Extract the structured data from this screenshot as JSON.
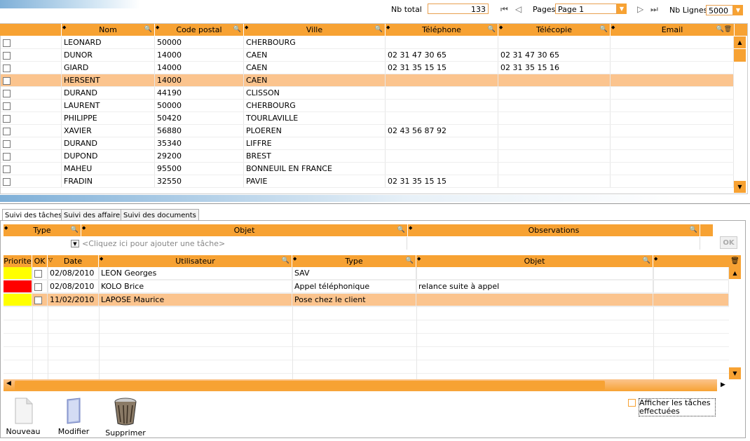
{
  "header": {
    "nb_total_label": "Nb total",
    "nb_total_value": "133",
    "pages_label": "Pages",
    "page_value": "Page 1",
    "nb_lignes_label": "Nb Lignes",
    "nb_lignes_value": "5000"
  },
  "contacts": {
    "columns": [
      "Nom",
      "Code postal",
      "Ville",
      "Téléphone",
      "Télécopie",
      "Email"
    ],
    "rows": [
      [
        "LEONARD",
        "50000",
        "CHERBOURG",
        "",
        "",
        ""
      ],
      [
        "DUNOR",
        "14000",
        "CAEN",
        "02 31 47 30 65",
        "02 31 47 30 65",
        ""
      ],
      [
        "GIARD",
        "14000",
        "CAEN",
        "02 31 35 15 15",
        "02 31 35 15 16",
        ""
      ],
      [
        "HERSENT",
        "14000",
        "CAEN",
        "",
        "",
        ""
      ],
      [
        "DURAND",
        "44190",
        "CLISSON",
        "",
        "",
        ""
      ],
      [
        "LAURENT",
        "50000",
        "CHERBOURG",
        "",
        "",
        ""
      ],
      [
        "PHILIPPE",
        "50420",
        "TOURLAVILLE",
        "",
        "",
        ""
      ],
      [
        "XAVIER",
        "56880",
        "PLOEREN",
        "02 43 56 87 92",
        "",
        ""
      ],
      [
        "DURAND",
        "35340",
        "LIFFRE",
        "",
        "",
        ""
      ],
      [
        "DUPOND",
        "29200",
        "BREST",
        "",
        "",
        ""
      ],
      [
        "MAHEU",
        "95500",
        "BONNEUIL EN FRANCE",
        "",
        "",
        ""
      ],
      [
        "FRADIN",
        "32550",
        "PAVIE",
        "02 31 35 15 15",
        "",
        ""
      ]
    ],
    "selected_index": 3
  },
  "tabs": [
    "Suivi des tâches",
    "Suivi des affaires",
    "Suivi des documents"
  ],
  "task_entry": {
    "columns": [
      "Type",
      "Objet",
      "Observations"
    ],
    "placeholder": "<Cliquez ici pour ajouter une tâche>",
    "ok_label": "OK"
  },
  "tasks": {
    "columns": [
      "Priorite",
      "OK",
      "Date",
      "Utilisateur",
      "Type",
      "Objet"
    ],
    "rows": [
      {
        "priority_color": "#ffff00",
        "date": "02/08/2010",
        "user": "LEON Georges",
        "type": "SAV",
        "objet": ""
      },
      {
        "priority_color": "#ff0000",
        "date": "02/08/2010",
        "user": "KOLO Brice",
        "type": "Appel téléphonique",
        "objet": "relance suite à appel"
      },
      {
        "priority_color": "#ffff00",
        "date": "11/02/2010",
        "user": "LAPOSE Maurice",
        "type": "Pose chez le client",
        "objet": ""
      }
    ],
    "selected_index": 2
  },
  "toolbar": {
    "new_label": "Nouveau",
    "edit_label": "Modifier",
    "delete_label": "Supprimer"
  },
  "show_done_label": "Afficher les tâches effectuées",
  "colors": {
    "accent": "#f7a233",
    "selected_row": "#fbc48e"
  }
}
